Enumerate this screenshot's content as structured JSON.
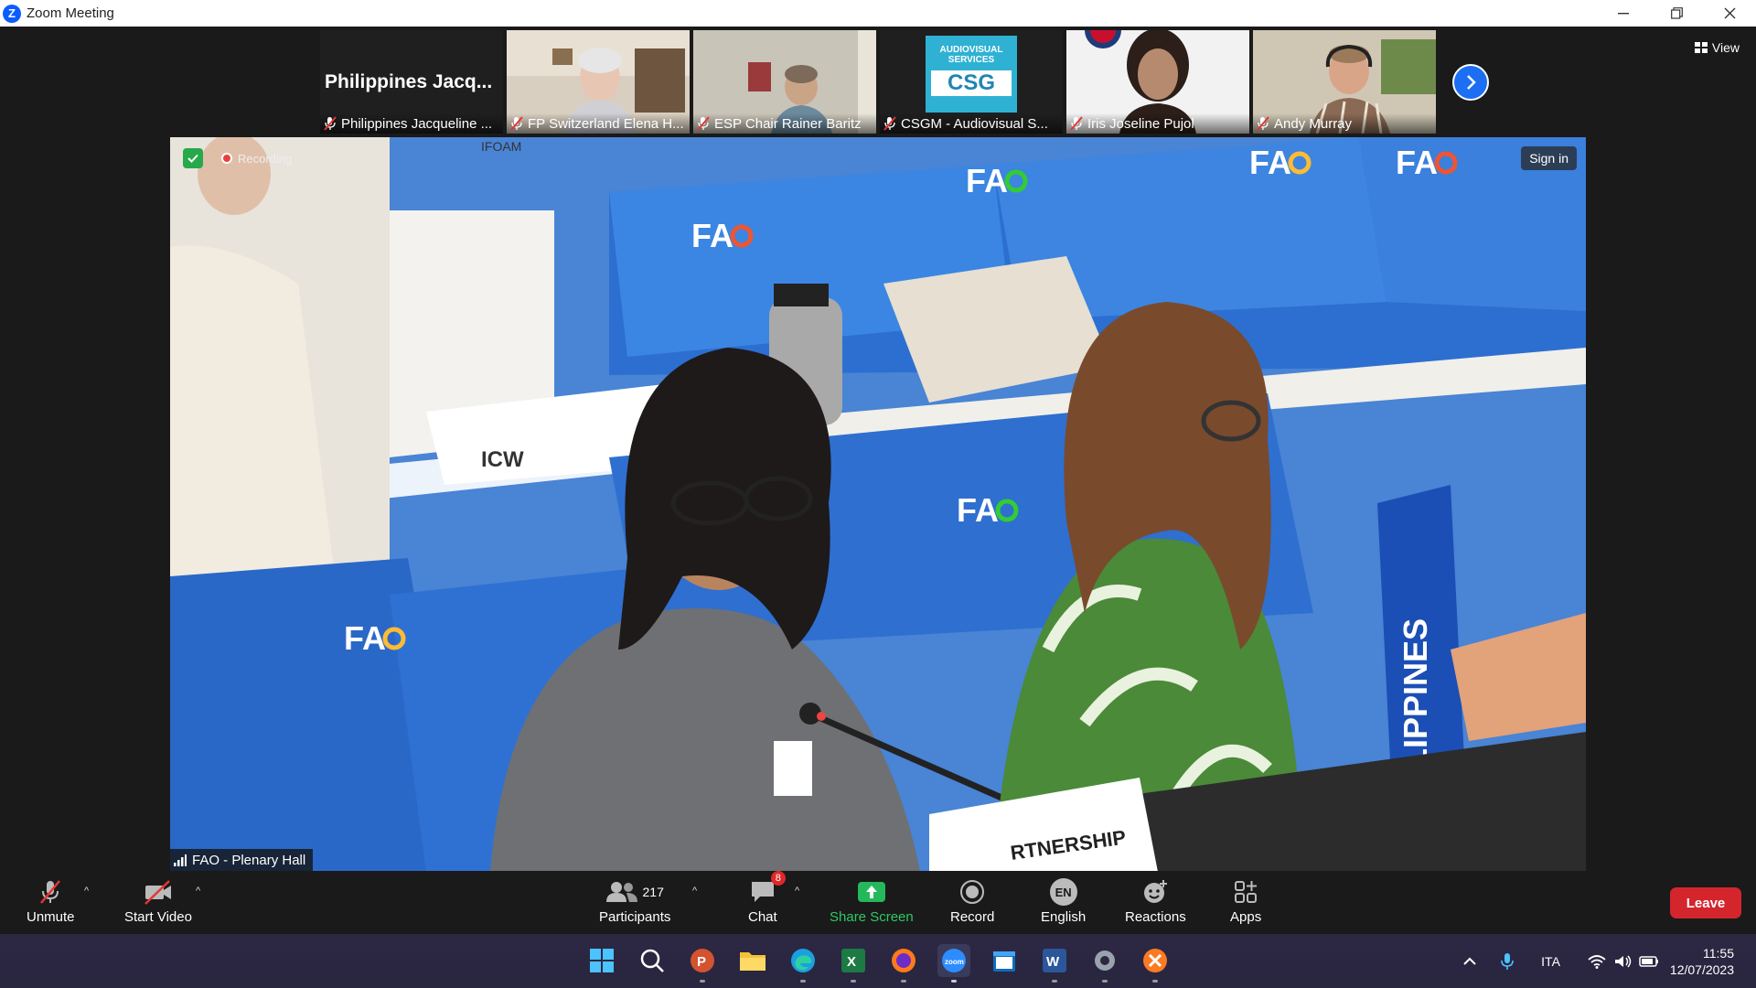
{
  "window": {
    "title": "Zoom Meeting"
  },
  "thumbnails": [
    {
      "big_name": "Philippines  Jacq...",
      "label": "Philippines Jacqueline ..."
    },
    {
      "label": "FP Switzerland Elena H..."
    },
    {
      "label": "ESP Chair Rainer Baritz"
    },
    {
      "label": "CSGM - Audiovisual S...",
      "logo_top": "AUDIOVISUAL SERVICES",
      "logo_bottom": "CSG"
    },
    {
      "label": "Iris Joseline Pujol"
    },
    {
      "label": "Andy Murray"
    }
  ],
  "view_button": "View",
  "video": {
    "recording_label": "Recording",
    "signin_label": "Sign in",
    "room_label": "FAO - Plenary Hall",
    "scene": {
      "fao_text": "FA",
      "sign_text": "PHILIPPINES",
      "card_text": "ICW",
      "ifoam_text": "IFOAM",
      "bottom_sign_text": "RTNERSHIP"
    }
  },
  "toolbar": {
    "unmute": "Unmute",
    "start_video": "Start Video",
    "participants_count": "217",
    "participants": "Participants",
    "chat_badge": "8",
    "chat": "Chat",
    "share_screen": "Share Screen",
    "record": "Record",
    "language_code": "EN",
    "english": "English",
    "reactions": "Reactions",
    "apps": "Apps",
    "leave": "Leave"
  },
  "taskbar": {
    "language": "ITA",
    "time": "11:55",
    "date": "12/07/2023"
  },
  "colors": {
    "accent_blue": "#0b5cff",
    "leave_red": "#d4252d",
    "share_green": "#2ec866",
    "chair_blue": "#2f6fd0"
  }
}
